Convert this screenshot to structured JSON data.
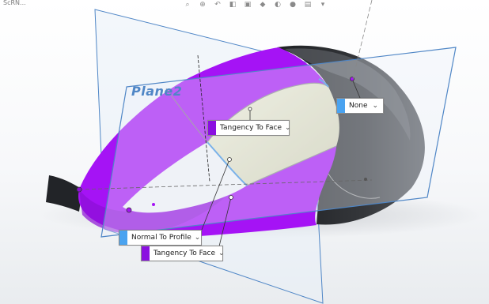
{
  "window": {
    "corner_text": "ScRN..."
  },
  "toolbar": {
    "icons": [
      "zoom-fit-icon",
      "zoom-area-icon",
      "previous-view-icon",
      "section-view-icon",
      "view-orientation-icon",
      "display-style-icon",
      "hide-show-icon",
      "appearance-icon",
      "scene-icon",
      "view-settings-icon"
    ]
  },
  "viewport": {
    "plane_label": "Plane2",
    "colors": {
      "boundary_surface": "#a513f5",
      "boundary_surface_dark": "#8c0fd6",
      "loft_face": "#e3e2c5",
      "body_dark": "#2b2d31",
      "body_mid": "#4a4d52",
      "plane_edge": "#4f86c6",
      "plane_fill": "#eaf0f8",
      "curve_blue": "#3d8fe0",
      "normal_swatch": "#4aa3f0",
      "tangency_swatch": "#8a10e0"
    }
  },
  "callouts": {
    "tangency_top": {
      "label": "Tangency To Face",
      "swatch": "#8a10e0"
    },
    "none": {
      "label": "None",
      "swatch": "#4aa3f0"
    },
    "normal_to_profile": {
      "label": "Normal To Profile",
      "swatch": "#4aa3f0"
    },
    "tangency_bottom": {
      "label": "Tangency To Face",
      "swatch": "#8a10e0"
    }
  }
}
